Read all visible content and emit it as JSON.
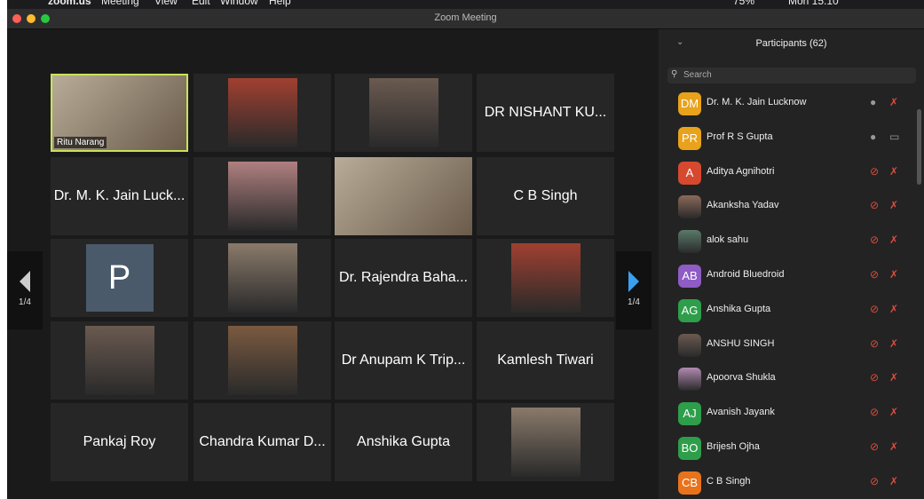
{
  "menubar": {
    "app": "zoom.us",
    "items": [
      "Meeting",
      "View",
      "Edit",
      "Window",
      "Help"
    ],
    "battery": "75%",
    "clock": "Mon 15:10"
  },
  "window": {
    "title": "Zoom Meeting"
  },
  "pager": {
    "label": "1/4"
  },
  "tiles": [
    {
      "name": "Ritu Narang",
      "kind": "video",
      "active": true
    },
    {
      "name": "",
      "kind": "photo"
    },
    {
      "name": "",
      "kind": "photo"
    },
    {
      "name": "DR NISHANT KU...",
      "kind": "name"
    },
    {
      "name": "Dr. M. K. Jain Luck...",
      "kind": "name"
    },
    {
      "name": "",
      "kind": "photo"
    },
    {
      "name": "",
      "kind": "video"
    },
    {
      "name": "C B Singh",
      "kind": "name"
    },
    {
      "name": "P",
      "kind": "avatar"
    },
    {
      "name": "",
      "kind": "photo"
    },
    {
      "name": "Dr. Rajendra Baha...",
      "kind": "name"
    },
    {
      "name": "",
      "kind": "photo"
    },
    {
      "name": "",
      "kind": "photo"
    },
    {
      "name": "",
      "kind": "photo"
    },
    {
      "name": "Dr Anupam K Trip...",
      "kind": "name"
    },
    {
      "name": "Kamlesh Tiwari",
      "kind": "name"
    },
    {
      "name": "Pankaj Roy",
      "kind": "name"
    },
    {
      "name": "Chandra Kumar D...",
      "kind": "name"
    },
    {
      "name": "Anshika Gupta",
      "kind": "name"
    },
    {
      "name": "",
      "kind": "photo"
    }
  ],
  "panel": {
    "title": "Participants (62)",
    "search_placeholder": "Search",
    "participants": [
      {
        "initials": "DM",
        "name": "Dr. M. K. Jain Lucknow",
        "color": "#e8a21c",
        "muted": false,
        "video_off": true
      },
      {
        "initials": "PR",
        "name": "Prof R S Gupta",
        "color": "#e8a21c",
        "muted": false,
        "video_off": false
      },
      {
        "initials": "A",
        "name": "Aditya Agnihotri",
        "color": "#d6492f",
        "muted": true,
        "video_off": true
      },
      {
        "initials": "",
        "name": "Akanksha Yadav",
        "color": "#8a6a5a",
        "muted": true,
        "video_off": true
      },
      {
        "initials": "",
        "name": "alok sahu",
        "color": "#5a7a6a",
        "muted": true,
        "video_off": true
      },
      {
        "initials": "AB",
        "name": "Android Bluedroid",
        "color": "#8e5cc4",
        "muted": true,
        "video_off": true
      },
      {
        "initials": "AG",
        "name": "Anshika Gupta",
        "color": "#2e9e4a",
        "muted": true,
        "video_off": true
      },
      {
        "initials": "",
        "name": "ANSHU SINGH",
        "color": "#6a5a50",
        "muted": true,
        "video_off": true
      },
      {
        "initials": "",
        "name": "Apoorva Shukla",
        "color": "#b08ab0",
        "muted": true,
        "video_off": true
      },
      {
        "initials": "AJ",
        "name": "Avanish Jayank",
        "color": "#2e9e4a",
        "muted": true,
        "video_off": true
      },
      {
        "initials": "BO",
        "name": "Brijesh Ojha",
        "color": "#2e9e4a",
        "muted": true,
        "video_off": true
      },
      {
        "initials": "CB",
        "name": "C B Singh",
        "color": "#e8731c",
        "muted": true,
        "video_off": true
      }
    ]
  },
  "colors": {
    "active_speaker": "#c9e25a",
    "pager_arrow_right": "#3aa0f0",
    "muted_red": "#e04b3c"
  }
}
